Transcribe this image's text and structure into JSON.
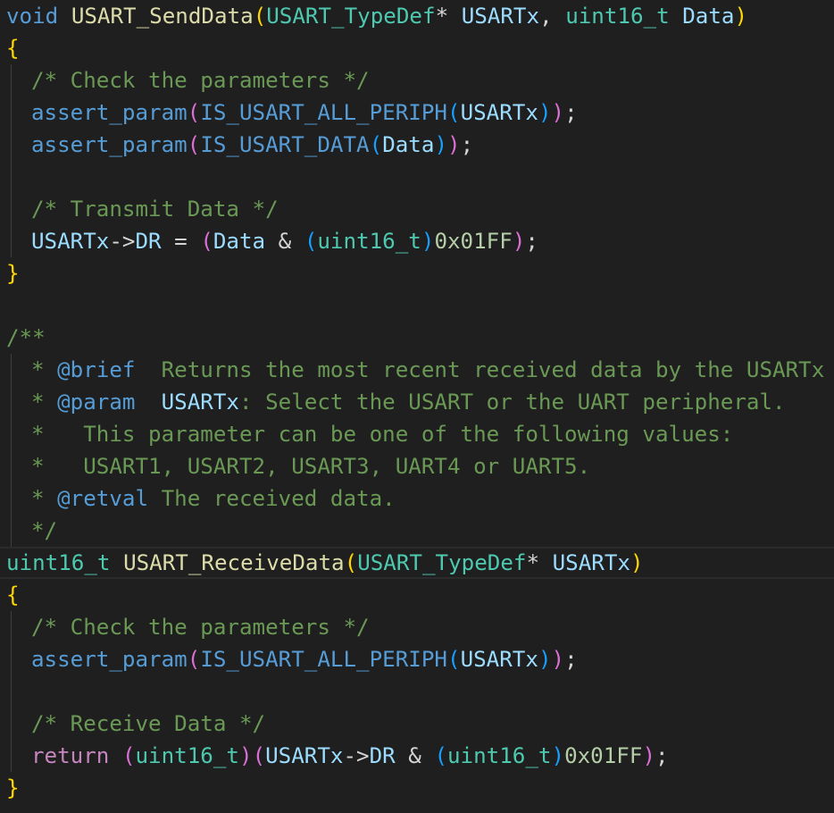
{
  "editor": {
    "lines": [
      {
        "indent": 0,
        "tokens": [
          {
            "t": "void",
            "c": "kw"
          },
          {
            "t": " "
          },
          {
            "t": "USART_SendData",
            "c": "fn"
          },
          {
            "t": "(",
            "c": "p1"
          },
          {
            "t": "USART_TypeDef",
            "c": "ty"
          },
          {
            "t": "* ",
            "c": "op"
          },
          {
            "t": "USARTx",
            "c": "pm"
          },
          {
            "t": ", ",
            "c": "op"
          },
          {
            "t": "uint16_t",
            "c": "ty"
          },
          {
            "t": " "
          },
          {
            "t": "Data",
            "c": "pm"
          },
          {
            "t": ")",
            "c": "p1"
          }
        ]
      },
      {
        "indent": 0,
        "tokens": [
          {
            "t": "{",
            "c": "p1"
          }
        ]
      },
      {
        "indent": 1,
        "tokens": [
          {
            "t": "/* Check the parameters */",
            "c": "cm"
          }
        ]
      },
      {
        "indent": 1,
        "tokens": [
          {
            "t": "assert_param",
            "c": "call"
          },
          {
            "t": "(",
            "c": "p2"
          },
          {
            "t": "IS_USART_ALL_PERIPH",
            "c": "call"
          },
          {
            "t": "(",
            "c": "p3"
          },
          {
            "t": "USARTx",
            "c": "pm"
          },
          {
            "t": ")",
            "c": "p3"
          },
          {
            "t": ")",
            "c": "p2"
          },
          {
            "t": ";",
            "c": "op"
          }
        ]
      },
      {
        "indent": 1,
        "tokens": [
          {
            "t": "assert_param",
            "c": "call"
          },
          {
            "t": "(",
            "c": "p2"
          },
          {
            "t": "IS_USART_DATA",
            "c": "call"
          },
          {
            "t": "(",
            "c": "p3"
          },
          {
            "t": "Data",
            "c": "pm"
          },
          {
            "t": ")",
            "c": "p3"
          },
          {
            "t": ")",
            "c": "p2"
          },
          {
            "t": ";",
            "c": "op"
          }
        ]
      },
      {
        "indent": 1,
        "tokens": []
      },
      {
        "indent": 1,
        "tokens": [
          {
            "t": "/* Transmit Data */",
            "c": "cm"
          }
        ]
      },
      {
        "indent": 1,
        "tokens": [
          {
            "t": "USARTx",
            "c": "pm"
          },
          {
            "t": "->",
            "c": "op"
          },
          {
            "t": "DR",
            "c": "pm"
          },
          {
            "t": " = ",
            "c": "op"
          },
          {
            "t": "(",
            "c": "p2"
          },
          {
            "t": "Data",
            "c": "pm"
          },
          {
            "t": " & ",
            "c": "op"
          },
          {
            "t": "(",
            "c": "p3"
          },
          {
            "t": "uint16_t",
            "c": "ty"
          },
          {
            "t": ")",
            "c": "p3"
          },
          {
            "t": "0x01FF",
            "c": "num"
          },
          {
            "t": ")",
            "c": "p2"
          },
          {
            "t": ";",
            "c": "op"
          }
        ]
      },
      {
        "indent": 0,
        "tokens": [
          {
            "t": "}",
            "c": "p1"
          }
        ]
      },
      {
        "indent": 0,
        "tokens": []
      },
      {
        "indent": 0,
        "tokens": [
          {
            "t": "/**",
            "c": "cm"
          }
        ]
      },
      {
        "indent": 1,
        "tokens": [
          {
            "t": "* ",
            "c": "cm"
          },
          {
            "t": "@brief",
            "c": "tag"
          },
          {
            "t": "  Returns the most recent received data by the USARTx p",
            "c": "cm"
          }
        ]
      },
      {
        "indent": 1,
        "tokens": [
          {
            "t": "* ",
            "c": "cm"
          },
          {
            "t": "@param",
            "c": "tag"
          },
          {
            "t": "  "
          },
          {
            "t": "USARTx",
            "c": "pm"
          },
          {
            "t": ": Select the USART or the UART peripheral.",
            "c": "cm"
          }
        ]
      },
      {
        "indent": 1,
        "tokens": [
          {
            "t": "*   This parameter can be one of the following values:",
            "c": "cm"
          }
        ]
      },
      {
        "indent": 1,
        "tokens": [
          {
            "t": "*   USART1, USART2, USART3, UART4 or UART5.",
            "c": "cm"
          }
        ]
      },
      {
        "indent": 1,
        "tokens": [
          {
            "t": "* ",
            "c": "cm"
          },
          {
            "t": "@retval",
            "c": "tag"
          },
          {
            "t": " The received data.",
            "c": "cm"
          }
        ]
      },
      {
        "indent": 1,
        "tokens": [
          {
            "t": "*/",
            "c": "cm"
          }
        ]
      },
      {
        "indent": 0,
        "current": true,
        "tokens": [
          {
            "t": "uint16_t",
            "c": "ty"
          },
          {
            "t": " "
          },
          {
            "t": "USART_ReceiveData",
            "c": "fn"
          },
          {
            "t": "(",
            "c": "p1"
          },
          {
            "t": "USART_TypeDef",
            "c": "ty"
          },
          {
            "t": "* ",
            "c": "op"
          },
          {
            "t": "USARTx",
            "c": "pm"
          },
          {
            "t": ")",
            "c": "p1"
          }
        ]
      },
      {
        "indent": 0,
        "tokens": [
          {
            "t": "{",
            "c": "p1"
          }
        ]
      },
      {
        "indent": 1,
        "tokens": [
          {
            "t": "/* Check the parameters */",
            "c": "cm"
          }
        ]
      },
      {
        "indent": 1,
        "tokens": [
          {
            "t": "assert_param",
            "c": "call"
          },
          {
            "t": "(",
            "c": "p2"
          },
          {
            "t": "IS_USART_ALL_PERIPH",
            "c": "call"
          },
          {
            "t": "(",
            "c": "p3"
          },
          {
            "t": "USARTx",
            "c": "pm"
          },
          {
            "t": ")",
            "c": "p3"
          },
          {
            "t": ")",
            "c": "p2"
          },
          {
            "t": ";",
            "c": "op"
          }
        ]
      },
      {
        "indent": 1,
        "tokens": []
      },
      {
        "indent": 1,
        "tokens": [
          {
            "t": "/* Receive Data */",
            "c": "cm"
          }
        ]
      },
      {
        "indent": 1,
        "tokens": [
          {
            "t": "return",
            "c": "ctl"
          },
          {
            "t": " "
          },
          {
            "t": "(",
            "c": "p2"
          },
          {
            "t": "uint16_t",
            "c": "ty"
          },
          {
            "t": ")",
            "c": "p2"
          },
          {
            "t": "(",
            "c": "p2"
          },
          {
            "t": "USARTx",
            "c": "pm"
          },
          {
            "t": "->",
            "c": "op"
          },
          {
            "t": "DR",
            "c": "pm"
          },
          {
            "t": " & ",
            "c": "op"
          },
          {
            "t": "(",
            "c": "p3"
          },
          {
            "t": "uint16_t",
            "c": "ty"
          },
          {
            "t": ")",
            "c": "p3"
          },
          {
            "t": "0x01FF",
            "c": "num"
          },
          {
            "t": ")",
            "c": "p2"
          },
          {
            "t": ";",
            "c": "op"
          }
        ]
      },
      {
        "indent": 0,
        "tokens": [
          {
            "t": "}",
            "c": "p1"
          }
        ]
      }
    ]
  }
}
